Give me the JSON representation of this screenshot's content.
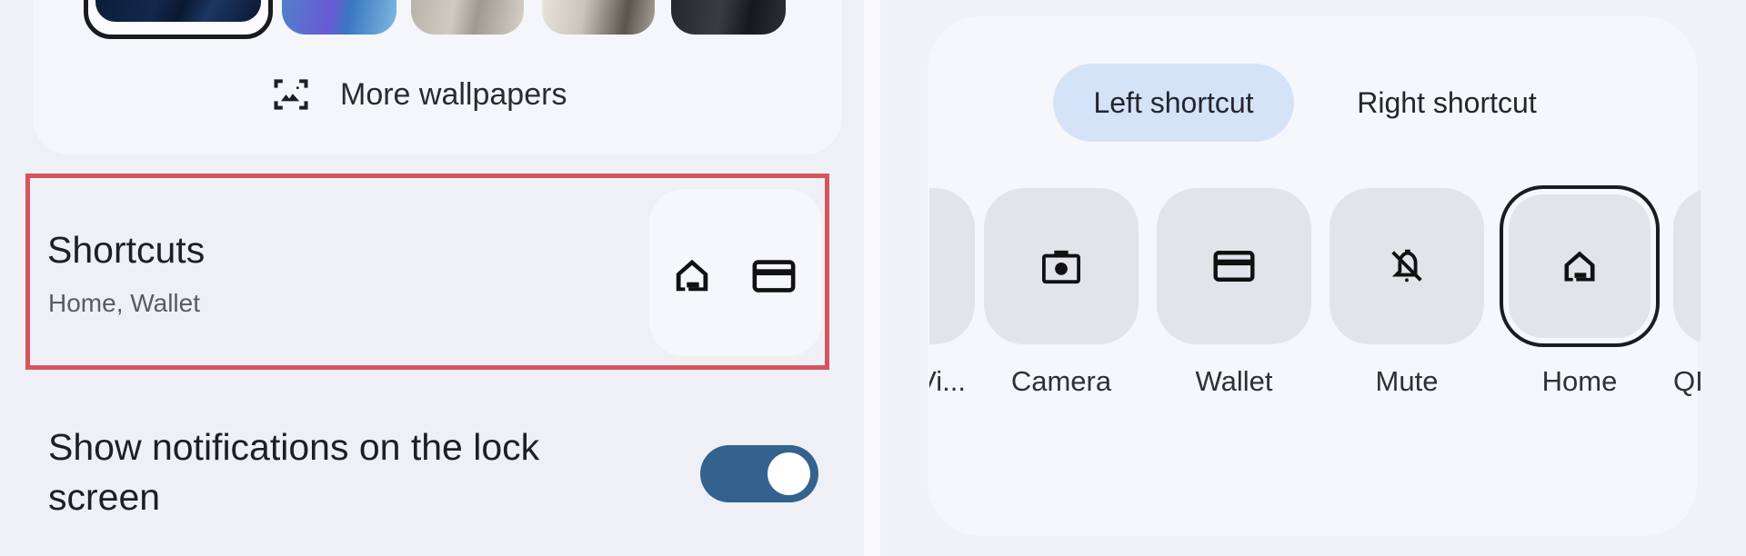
{
  "left_panel": {
    "wallpapers": {
      "thumbnails": [
        {
          "name": "dark-blue-lines",
          "selected": true
        },
        {
          "name": "blue-purple-waves",
          "selected": false
        },
        {
          "name": "beige-fabric",
          "selected": false
        },
        {
          "name": "white-fur",
          "selected": false
        },
        {
          "name": "black-fur",
          "selected": false
        }
      ],
      "more_label": "More wallpapers",
      "more_icon": "wallpaper-icon"
    },
    "shortcuts": {
      "title": "Shortcuts",
      "subtitle": "Home, Wallet",
      "preview_icons": [
        "home-icon",
        "wallet-icon"
      ],
      "highlight_color": "#d4555d"
    },
    "notifications": {
      "label": "Show notifications on the lock screen",
      "toggle_on": true,
      "toggle_color": "#33628f"
    }
  },
  "right_panel": {
    "tabs": [
      {
        "label": "Left shortcut",
        "selected": true
      },
      {
        "label": "Right shortcut",
        "selected": false
      }
    ],
    "options": [
      {
        "label": "Vi...",
        "icon": "partial-icon",
        "selected": false,
        "partial": true
      },
      {
        "label": "Camera",
        "icon": "camera-icon",
        "selected": false
      },
      {
        "label": "Wallet",
        "icon": "wallet-icon",
        "selected": false
      },
      {
        "label": "Mute",
        "icon": "mute-icon",
        "selected": false
      },
      {
        "label": "Home",
        "icon": "home-icon",
        "selected": true
      },
      {
        "label": "QI",
        "icon": "qr-icon",
        "selected": false,
        "partial": true
      }
    ],
    "selected_tab_color": "#d4e3f8"
  }
}
